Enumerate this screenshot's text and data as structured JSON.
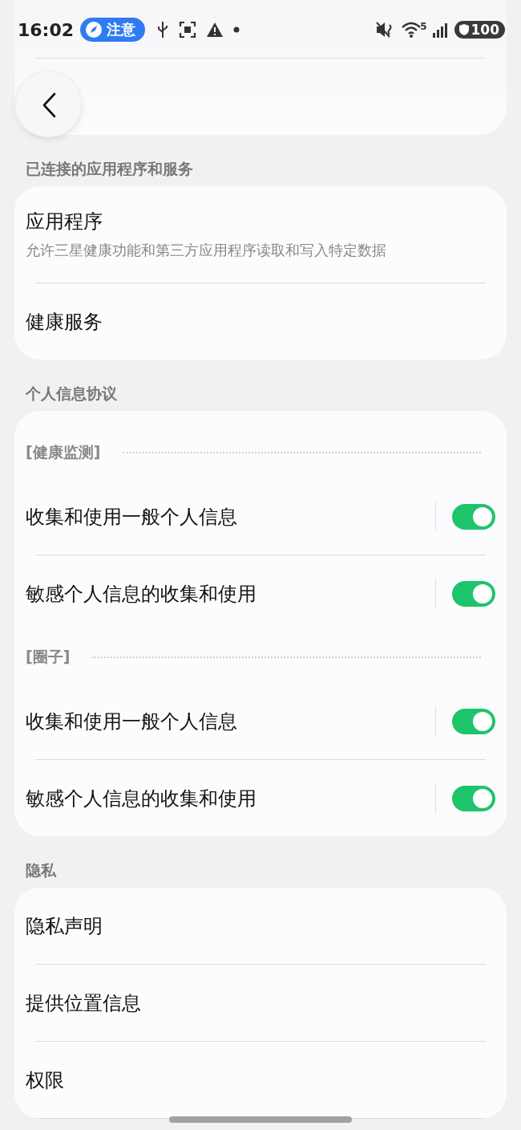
{
  "status_bar": {
    "time": "16:02",
    "notification": "注意",
    "wifi_label": "5",
    "battery": "100"
  },
  "sections": [
    {
      "header": "已连接的应用程序和服务",
      "items": [
        {
          "kind": "link",
          "title": "应用程序",
          "subtitle": "允许三星健康功能和第三方应用程序读取和写入特定数据"
        },
        {
          "kind": "link",
          "title": "健康服务"
        }
      ]
    },
    {
      "header": "个人信息协议",
      "items": [
        {
          "kind": "group",
          "title": "[健康监测]"
        },
        {
          "kind": "toggle",
          "title": "收集和使用一般个人信息",
          "on": true
        },
        {
          "kind": "toggle",
          "title": "敏感个人信息的收集和使用",
          "on": true
        },
        {
          "kind": "group",
          "title": "[圈子]"
        },
        {
          "kind": "toggle",
          "title": "收集和使用一般个人信息",
          "on": true
        },
        {
          "kind": "toggle",
          "title": "敏感个人信息的收集和使用",
          "on": true
        }
      ]
    },
    {
      "header": "隐私",
      "items": [
        {
          "kind": "link",
          "title": "隐私声明"
        },
        {
          "kind": "link",
          "title": "提供位置信息"
        },
        {
          "kind": "link",
          "title": "权限"
        }
      ]
    }
  ]
}
